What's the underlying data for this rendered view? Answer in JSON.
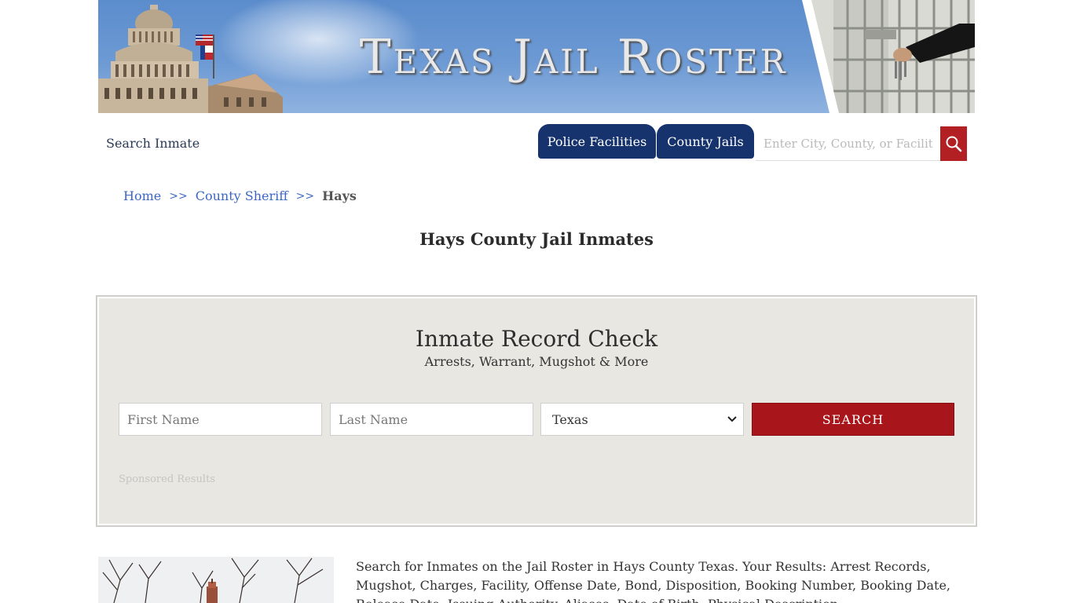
{
  "banner": {
    "title": "Texas Jail Roster"
  },
  "nav": {
    "search_inmate": "Search Inmate",
    "tab_police": "Police Facilities",
    "tab_county": "County Jails",
    "search_placeholder": "Enter City, County, or Facility"
  },
  "breadcrumb": {
    "home": "Home",
    "sep": ">>",
    "county_sheriff": "County Sheriff",
    "current": "Hays"
  },
  "page_title": "Hays County Jail Inmates",
  "record_check": {
    "title": "Inmate Record Check",
    "subtitle": "Arrests, Warrant, Mugshot & More",
    "first_name_placeholder": "First Name",
    "last_name_placeholder": "Last Name",
    "state_selected": "Texas",
    "search_label": "SEARCH",
    "sponsored": "Sponsored Results"
  },
  "description": "Search for Inmates on the Jail Roster in Hays County Texas. Your Results: Arrest Records, Mugshot, Charges, Facility, Offense Date, Bond, Disposition, Booking Number, Booking Date, Release Date, Issuing Authority, Aliases, Date of Birth, Physical Description",
  "colors": {
    "nav_blue": "#17336e",
    "accent_red": "#a8151b",
    "link_blue": "#3c66c4",
    "panel_bg": "#e8e7e2"
  }
}
